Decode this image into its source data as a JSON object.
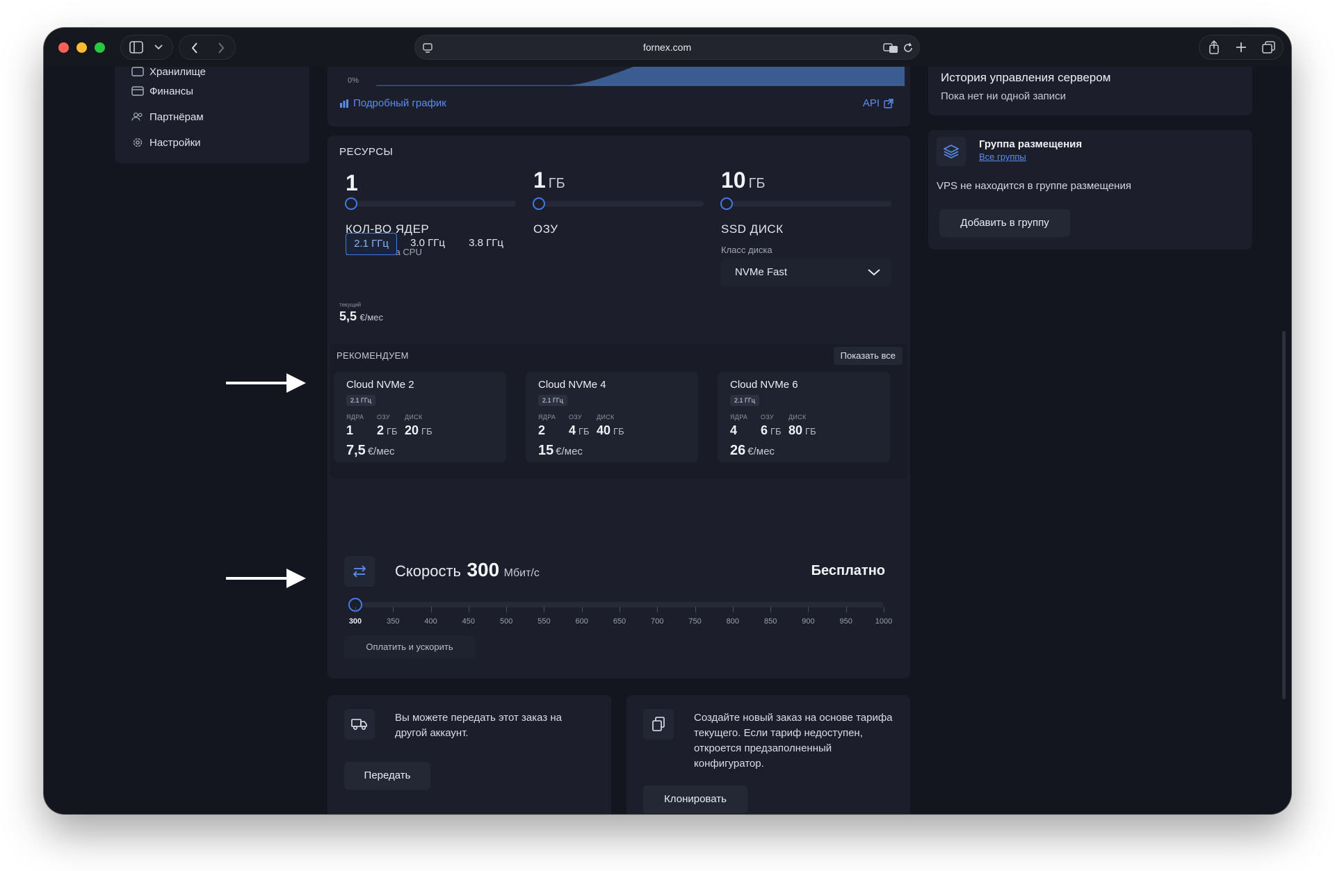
{
  "browser": {
    "url": "fornex.com"
  },
  "sidebar": {
    "items": [
      {
        "label": "Хранилище",
        "icon": "storage-icon"
      },
      {
        "label": "Финансы",
        "icon": "finance-icon"
      },
      {
        "label": "Партнёрам",
        "icon": "partners-icon"
      },
      {
        "label": "Настройки",
        "icon": "gear-icon"
      }
    ]
  },
  "graph": {
    "y_tick": "0%",
    "details_link": "Подробный график",
    "api_link": "API"
  },
  "resources": {
    "title": "РЕСУРСЫ",
    "cores": {
      "value": "1",
      "unit": "",
      "label": "КОЛ-ВО ЯДЕР"
    },
    "ram": {
      "value": "1",
      "unit": "ГБ",
      "label": "ОЗУ"
    },
    "disk": {
      "value": "10",
      "unit": "ГБ",
      "label": "SSD ДИСК"
    },
    "cpu_freq_label": "Мин. частота CPU",
    "cpu_freqs": [
      "2.1 ГГц",
      "3.0 ГГц",
      "3.8 ГГц"
    ],
    "disk_class_label": "Класс диска",
    "disk_class_value": "NVMe Fast",
    "current_label": "текущий",
    "current_price": "5,5",
    "current_unit": "€/мес"
  },
  "recommend": {
    "title": "РЕКОМЕНДУЕМ",
    "show_all": "Показать все",
    "labels": {
      "cores": "ЯДРА",
      "ram": "ОЗУ",
      "disk": "ДИСК",
      "gb": "ГБ",
      "price_unit": "€/мес"
    },
    "plans": [
      {
        "name": "Cloud NVMe 2",
        "freq": "2.1 ГГц",
        "cores": "1",
        "ram": "2",
        "disk": "20",
        "price": "7,5"
      },
      {
        "name": "Cloud NVMe 4",
        "freq": "2.1 ГГц",
        "cores": "2",
        "ram": "4",
        "disk": "40",
        "price": "15"
      },
      {
        "name": "Cloud NVMe 6",
        "freq": "2.1 ГГц",
        "cores": "4",
        "ram": "6",
        "disk": "80",
        "price": "26"
      }
    ]
  },
  "speed": {
    "label": "Скорость",
    "value": "300",
    "unit": "Мбит/с",
    "price": "Бесплатно",
    "ticks": [
      "300",
      "350",
      "400",
      "450",
      "500",
      "550",
      "600",
      "650",
      "700",
      "750",
      "800",
      "850",
      "900",
      "950",
      "1000"
    ],
    "pay_button": "Оплатить и ускорить"
  },
  "transfer": {
    "text": "Вы можете передать этот заказ на другой аккаунт.",
    "button": "Передать"
  },
  "clone": {
    "text": "Создайте новый заказ на основе тарифа текущего. Если тариф недоступен, откроется предзаполненный конфигуратор.",
    "button": "Клонировать"
  },
  "history": {
    "title": "История управления сервером",
    "empty": "Пока нет ни одной записи"
  },
  "placement": {
    "title": "Группа размещения",
    "link": "Все группы",
    "text": "VPS не находится в группе размещения",
    "button": "Добавить в группу"
  },
  "colors": {
    "accent": "#3f7be8",
    "background": "#14161f",
    "panel": "#1c1f2b"
  }
}
